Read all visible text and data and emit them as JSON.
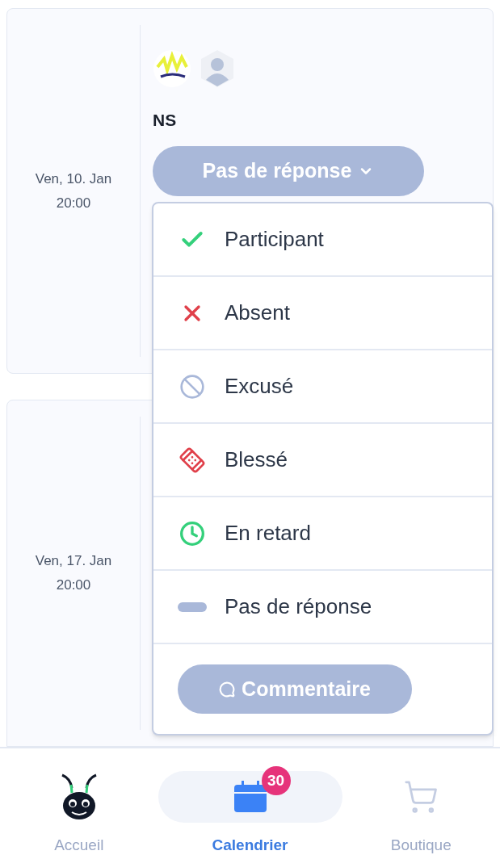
{
  "events": [
    {
      "date": "Ven, 10. Jan",
      "time": "20:00",
      "team": "NS",
      "status": "Pas de réponse"
    },
    {
      "date": "Ven, 17. Jan",
      "time": "20:00"
    }
  ],
  "status_menu": {
    "options": [
      {
        "label": "Participant",
        "kind": "check"
      },
      {
        "label": "Absent",
        "kind": "cross"
      },
      {
        "label": "Excusé",
        "kind": "excused"
      },
      {
        "label": "Blessé",
        "kind": "injured"
      },
      {
        "label": "En retard",
        "kind": "late"
      },
      {
        "label": "Pas de réponse",
        "kind": "none"
      }
    ],
    "comment_button": "Commentaire"
  },
  "bottom_nav": [
    {
      "label": "Accueil",
      "kind": "mascot",
      "selected": false
    },
    {
      "label": "Calendrier",
      "kind": "calendar",
      "selected": true,
      "badge": "30"
    },
    {
      "label": "Boutique",
      "kind": "cart",
      "selected": false
    }
  ]
}
